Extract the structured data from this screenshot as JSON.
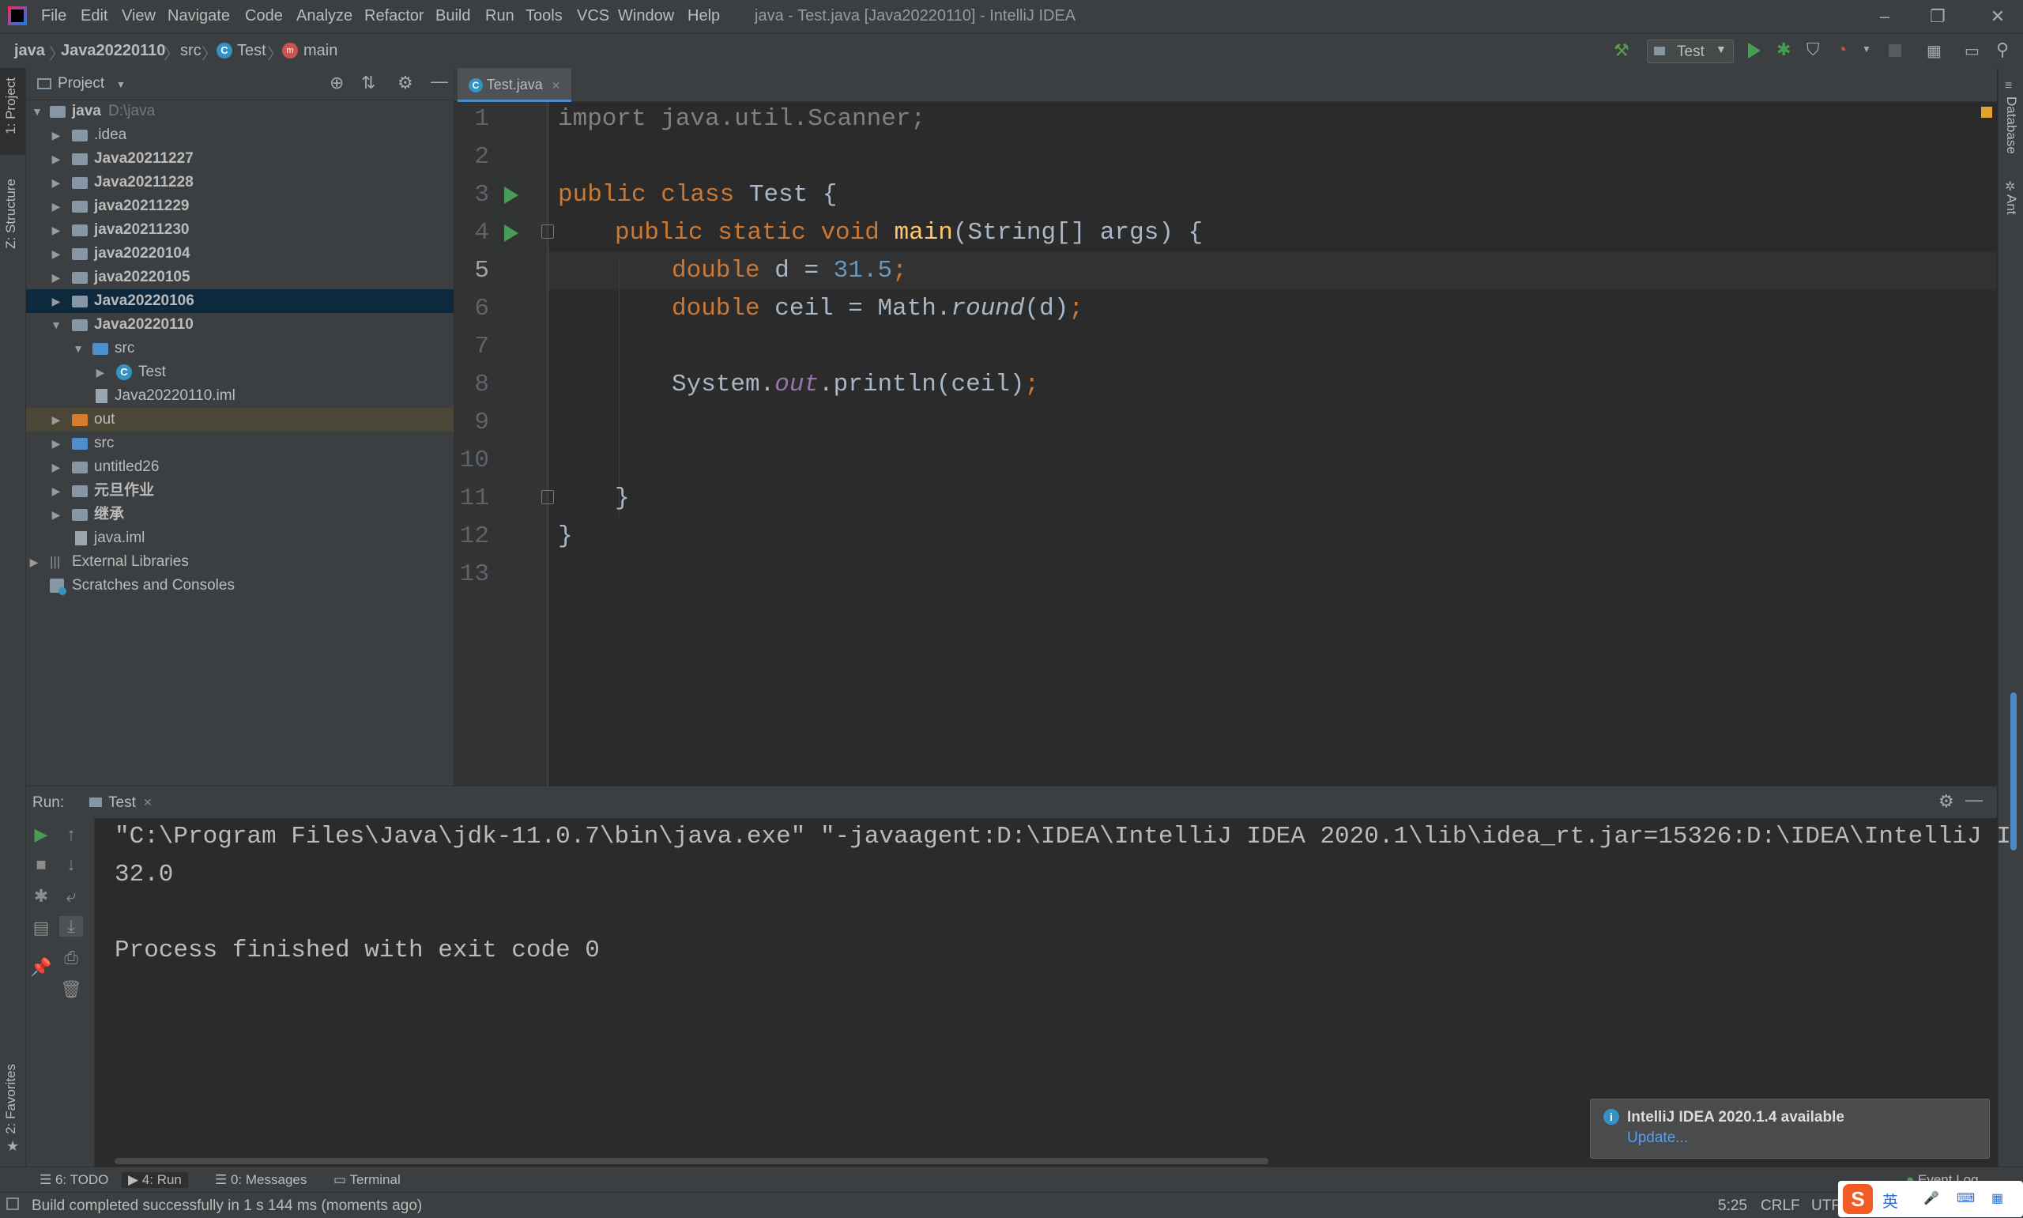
{
  "window": {
    "title": "java - Test.java [Java20220110] - IntelliJ IDEA",
    "menu": [
      "File",
      "Edit",
      "View",
      "Navigate",
      "Code",
      "Analyze",
      "Refactor",
      "Build",
      "Run",
      "Tools",
      "VCS",
      "Window",
      "Help"
    ]
  },
  "breadcrumb": {
    "items": [
      "java",
      "Java20220110",
      "src",
      "Test",
      "main"
    ]
  },
  "toolbar": {
    "run_config": "Test"
  },
  "left_stripe": {
    "project_tab": "1: Project",
    "structure_tab": "Z: Structure",
    "favorites_tab": "2: Favorites"
  },
  "right_stripe": {
    "database_tab": "Database",
    "ant_tab": "Ant"
  },
  "project": {
    "header": "Project",
    "root_name": "java",
    "root_path": "D:\\java",
    "items": [
      {
        "label": ".idea"
      },
      {
        "label": "Java20211227"
      },
      {
        "label": "Java20211228"
      },
      {
        "label": "java20211229"
      },
      {
        "label": "java20211230"
      },
      {
        "label": "java20220104"
      },
      {
        "label": "java20220105"
      },
      {
        "label": "Java20220106"
      },
      {
        "label": "Java20220110"
      },
      {
        "label": "src"
      },
      {
        "label": "Test"
      },
      {
        "label": "Java20220110.iml"
      },
      {
        "label": "out"
      },
      {
        "label": "src"
      },
      {
        "label": "untitled26"
      },
      {
        "label": "元旦作业"
      },
      {
        "label": "继承"
      },
      {
        "label": "java.iml"
      },
      {
        "label": "External Libraries"
      },
      {
        "label": "Scratches and Consoles"
      }
    ]
  },
  "editor": {
    "tab": "Test.java",
    "line_numbers": [
      "1",
      "2",
      "3",
      "4",
      "5",
      "6",
      "7",
      "8",
      "9",
      "10",
      "11",
      "12",
      "13"
    ],
    "current_line": "5",
    "code": {
      "l1": "import java.util.Scanner;",
      "l3_kw": "public class ",
      "l3_rest": "Test {",
      "l4_kw": "public static void ",
      "l4_fn": "main",
      "l4_rest": "(String[] args) {",
      "l5_kw": "double ",
      "l5_rest": "d = ",
      "l5_num": "31.5",
      "l5_end": ";",
      "l6_kw": "double ",
      "l6_rest": "ceil = Math.",
      "l6_ital": "round",
      "l6_rest2": "(d)",
      "l6_end": ";",
      "l8_a": "System.",
      "l8_field": "out",
      "l8_b": ".println(ceil)",
      "l8_end": ";",
      "l11": "}",
      "l12": "}"
    }
  },
  "run": {
    "label": "Run:",
    "tab": "Test",
    "output": [
      "\"C:\\Program Files\\Java\\jdk-11.0.7\\bin\\java.exe\" \"-javaagent:D:\\IDEA\\IntelliJ IDEA 2020.1\\lib\\idea_rt.jar=15326:D:\\IDEA\\IntelliJ IDEA",
      "32.0",
      "",
      "Process finished with exit code 0"
    ]
  },
  "bottom_tabs": {
    "todo": "6: TODO",
    "run": "4: Run",
    "messages": "0: Messages",
    "terminal": "Terminal",
    "event_log": "Event Log"
  },
  "notification": {
    "title": "IntelliJ IDEA 2020.1.4 available",
    "link": "Update..."
  },
  "status": {
    "message": "Build completed successfully in 1 s 144 ms (moments ago)",
    "position": "5:25",
    "line_sep": "CRLF",
    "encoding": "UTF-",
    "ime_label": "英"
  },
  "colors": {
    "accent": "#4a88c7",
    "run_green": "#499c54",
    "keyword": "#cc7832",
    "number": "#6897bb",
    "function": "#ffc66d"
  }
}
